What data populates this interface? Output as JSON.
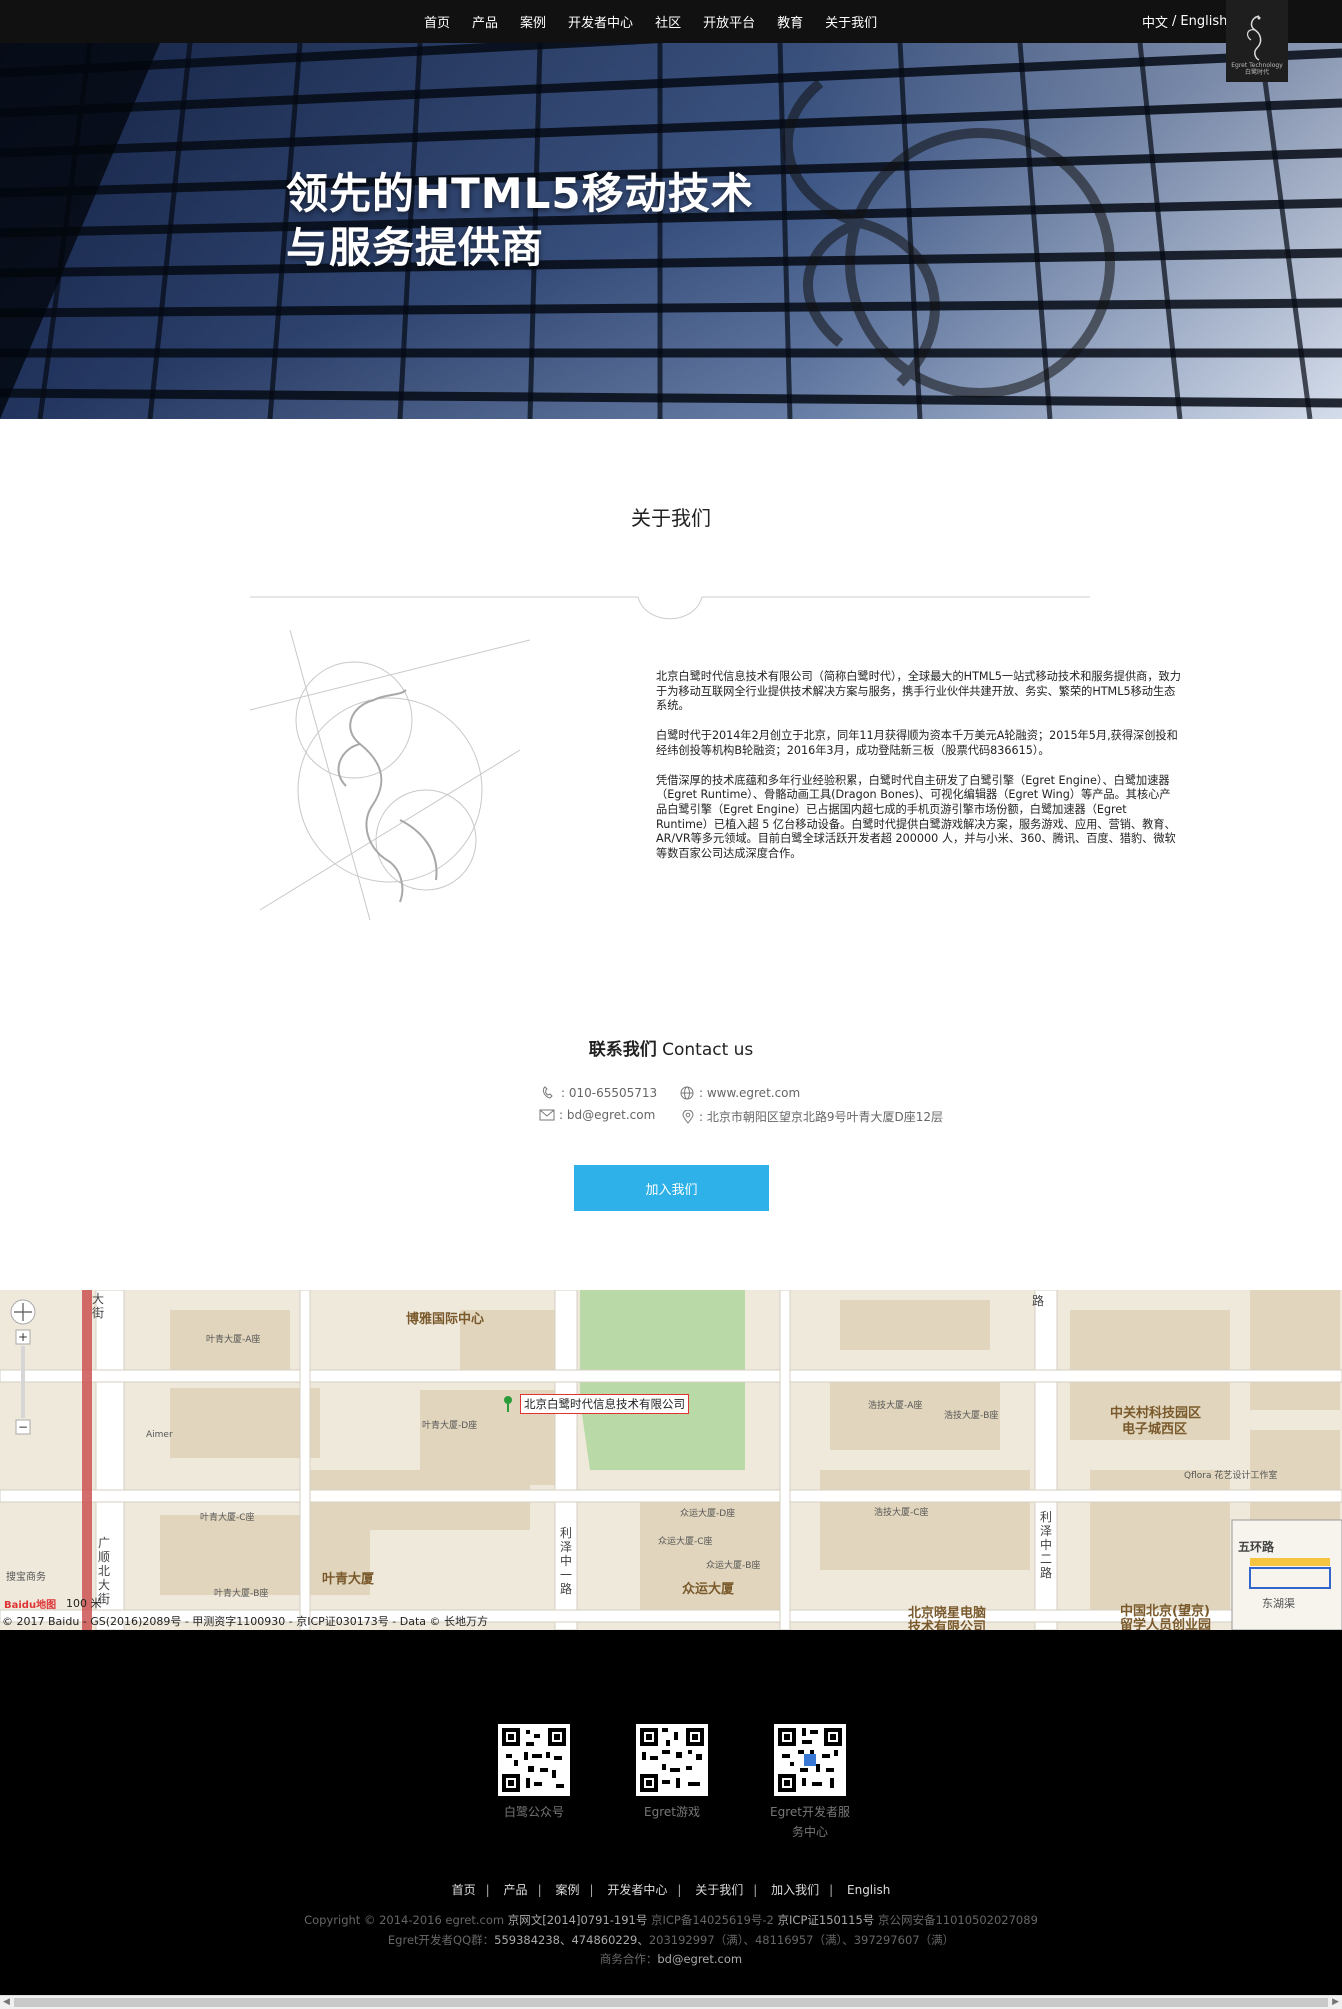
{
  "nav": {
    "items": [
      "首页",
      "产品",
      "案例",
      "开发者中心",
      "社区",
      "开放平台",
      "教育",
      "关于我们"
    ],
    "lang_cn": "中文",
    "lang_sep": "/",
    "lang_en": "English",
    "logo_caption_1": "Egret Technology",
    "logo_caption_2": "白鹭时代"
  },
  "hero": {
    "line1": "领先的HTML5移动技术",
    "line2": "与服务提供商"
  },
  "about": {
    "title": "关于我们",
    "p1": "北京白鹭时代信息技术有限公司（简称白鹭时代），全球最大的HTML5一站式移动技术和服务提供商，致力于为移动互联网全行业提供技术解决方案与服务，携手行业伙伴共建开放、务实、繁荣的HTML5移动生态系统。",
    "p2": "白鹭时代于2014年2月创立于北京，同年11月获得顺为资本千万美元A轮融资；2015年5月,获得深创投和经纬创投等机构B轮融资；2016年3月，成功登陆新三板（股票代码836615）。",
    "p3": "凭借深厚的技术底蕴和多年行业经验积累，白鹭时代自主研发了白鹭引擎（Egret Engine）、白鹭加速器（Egret Runtime）、骨骼动画工具(Dragon Bones)、可视化编辑器（Egret Wing）等产品。其核心产品白鹭引擎（Egret Engine）已占据国内超七成的手机页游引擎市场份额，白鹭加速器（Egret Runtime）已植入超 5 亿台移动设备。白鹭时代提供白鹭游戏解决方案，服务游戏、应用、营销、教育、AR/VR等多元领域。目前白鹭全球活跃开发者超 200000 人，并与小米、360、腾讯、百度、猎豹、微软等数百家公司达成深度合作。"
  },
  "contact": {
    "title_cn": "联系我们",
    "title_en": "Contact us",
    "phone": ": 010-65505713",
    "web": ": www.egret.com",
    "email": ": bd@egret.com",
    "address": ": 北京市朝阳区望京北路9号叶青大厦D座12层",
    "join_button": "加入我们"
  },
  "map": {
    "pin_label": "北京白鹭时代信息技术有限公司",
    "labels": {
      "bona": "博雅国际中心",
      "zhongguancun": "中关村科技园区",
      "dianzi": "电子城西区",
      "yeqing": "叶青大厦",
      "zhongyun": "众运大厦",
      "xiaoxing": "北京晓星电脑",
      "xiaoxing2": "技术有限公司",
      "liuxue": "中国北京(望京)",
      "liuxue2": "留学人员创业园",
      "lize_mid": "利泽中一路",
      "lize_two": "利泽中二路",
      "guangshun": "广顺北大街",
      "dajie": "大街",
      "lu": "路",
      "ring5": "五环路",
      "donghu": "东湖渠",
      "dashanzi": "搜宝商务",
      "bldg_a": "叶青大厦-A座",
      "bldg_b": "叶青大厦-B座",
      "bldg_c": "叶青大厦-C座",
      "bldg_d": "叶青大厦-D座",
      "zhongyun_d": "众运大厦-D座",
      "zhongyun_c": "众运大厦-C座",
      "zhongyun_b": "众运大厦-B座",
      "haoyun_a": "浩技大厦-A座",
      "haoyun_b": "浩技大厦-B座",
      "haoyun_c": "浩技大厦-C座",
      "aimer": "Aimer",
      "qflora": "Qflora 花艺设计工作室",
      "baidu_logo": "Baidu地图"
    },
    "scale": "100 米",
    "copyright": "© 2017 Baidu - GS(2016)2089号 - 甲测资字1100930 - 京ICP证030173号 - Data © 长地万方"
  },
  "footer": {
    "qr": [
      {
        "caption": "白鹭公众号"
      },
      {
        "caption": "Egret游戏"
      },
      {
        "caption": "Egret开发者服务中心"
      }
    ],
    "links": [
      "首页",
      "产品",
      "案例",
      "开发者中心",
      "关于我们",
      "加入我们",
      "English"
    ],
    "copyright": "Copyright © 2014-2016 egret.com",
    "icp1": "京网文[2014]0791-191号",
    "icp2": "京ICP备14025619号-2",
    "icp3": "京ICP证150115号",
    "police": "京公网安备11010502027089",
    "qq_label": "Egret开发者QQ群：",
    "qq_open": "559384238、474860229、",
    "qq_full": "203192997（满）、48116957（满）、397297607（满）",
    "biz_label": "商务合作：",
    "biz_email": "bd@egret.com"
  }
}
